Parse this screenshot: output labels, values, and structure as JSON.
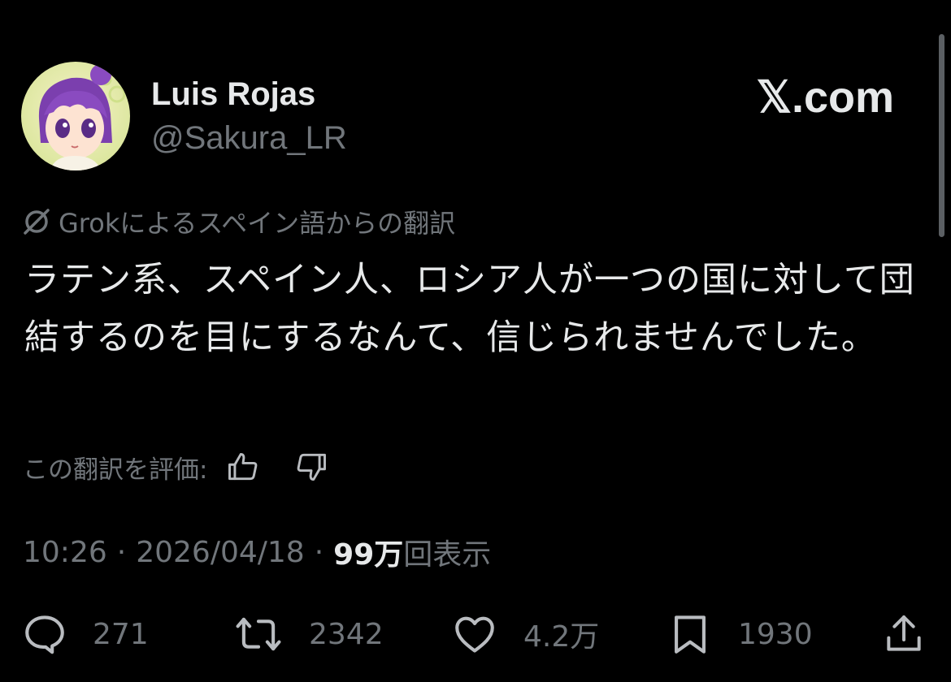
{
  "author": {
    "display_name": "Luis Rojas",
    "handle": "@Sakura_LR",
    "avatar_icon": "anime-girl-purple-hair-avatar"
  },
  "site_watermark": "𝕏.com",
  "translation": {
    "icon": "grok-icon",
    "label": "Grokによるスペイン語からの翻訳"
  },
  "tweet": {
    "text": "ラテン系、スペイン人、ロシア人が一つの国に対して団結するのを目にするなんて、信じられませんでした。"
  },
  "rating": {
    "label": "この翻訳を評価:",
    "thumbs_up_icon": "thumbs-up-icon",
    "thumbs_down_icon": "thumbs-down-icon"
  },
  "meta": {
    "time": "10:26",
    "separator": "·",
    "date": "2026/04/18",
    "views_count": "99万",
    "views_label": "回表示"
  },
  "actions": {
    "replies": "271",
    "retweets": "2342",
    "likes": "4.2万",
    "bookmarks": "1930"
  },
  "colors": {
    "background": "#000000",
    "primary_text": "#e7e9ea",
    "secondary_text": "#71767b"
  }
}
